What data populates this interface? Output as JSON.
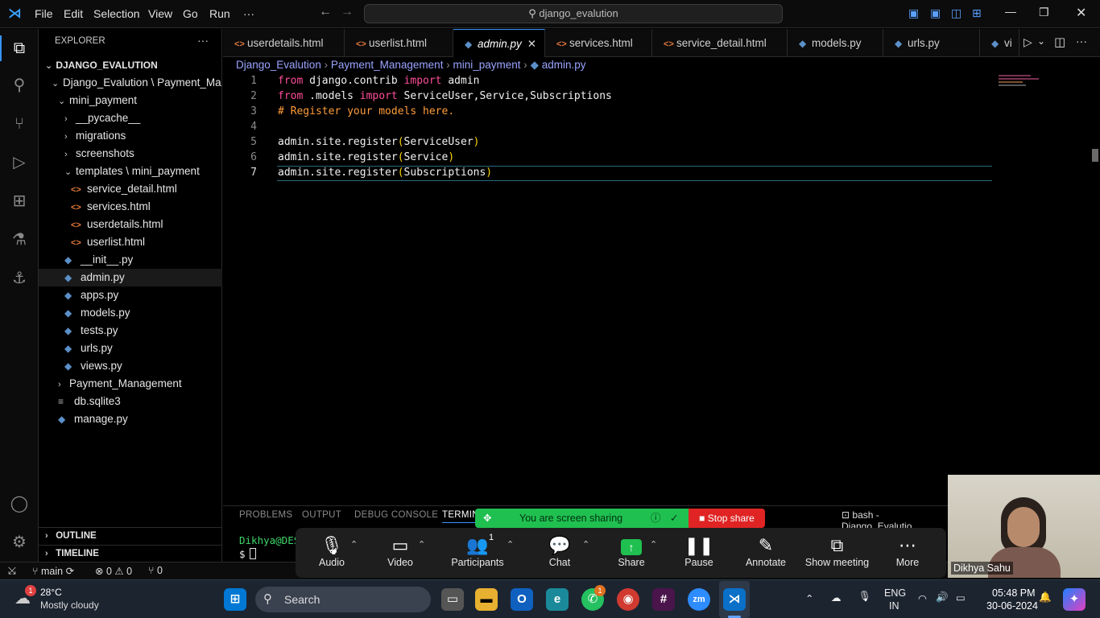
{
  "menu": {
    "file": "File",
    "edit": "Edit",
    "selection": "Selection",
    "view": "View",
    "go": "Go",
    "run": "Run",
    "more": "···"
  },
  "search": {
    "text": "django_evalution"
  },
  "explorer": {
    "title": "EXPLORER",
    "more": "···",
    "root": "DJANGO_EVALUTION",
    "items": [
      {
        "label": "Django_Evalution \\ Payment_Ma...",
        "indent": 1,
        "kind": "folder",
        "open": true
      },
      {
        "label": "mini_payment",
        "indent": 2,
        "kind": "folder",
        "open": true
      },
      {
        "label": "__pycache__",
        "indent": 3,
        "kind": "folder",
        "open": false
      },
      {
        "label": "migrations",
        "indent": 3,
        "kind": "folder",
        "open": false
      },
      {
        "label": "screenshots",
        "indent": 3,
        "kind": "folder",
        "open": false
      },
      {
        "label": "templates \\ mini_payment",
        "indent": 3,
        "kind": "folder",
        "open": true
      },
      {
        "label": "service_detail.html",
        "indent": 4,
        "kind": "html"
      },
      {
        "label": "services.html",
        "indent": 4,
        "kind": "html"
      },
      {
        "label": "userdetails.html",
        "indent": 4,
        "kind": "html"
      },
      {
        "label": "userlist.html",
        "indent": 4,
        "kind": "html"
      },
      {
        "label": "__init__.py",
        "indent": 3,
        "kind": "py"
      },
      {
        "label": "admin.py",
        "indent": 3,
        "kind": "py",
        "selected": true
      },
      {
        "label": "apps.py",
        "indent": 3,
        "kind": "py"
      },
      {
        "label": "models.py",
        "indent": 3,
        "kind": "py"
      },
      {
        "label": "tests.py",
        "indent": 3,
        "kind": "py"
      },
      {
        "label": "urls.py",
        "indent": 3,
        "kind": "py"
      },
      {
        "label": "views.py",
        "indent": 3,
        "kind": "py"
      },
      {
        "label": "Payment_Management",
        "indent": 2,
        "kind": "folder",
        "open": false
      },
      {
        "label": "db.sqlite3",
        "indent": 2,
        "kind": "db"
      },
      {
        "label": "manage.py",
        "indent": 2,
        "kind": "py"
      }
    ],
    "outline": "OUTLINE",
    "timeline": "TIMELINE"
  },
  "tabs": [
    {
      "label": "userdetails.html",
      "kind": "html"
    },
    {
      "label": "userlist.html",
      "kind": "html"
    },
    {
      "label": "admin.py",
      "kind": "py",
      "active": true
    },
    {
      "label": "services.html",
      "kind": "html"
    },
    {
      "label": "service_detail.html",
      "kind": "html"
    },
    {
      "label": "models.py",
      "kind": "py"
    },
    {
      "label": "urls.py",
      "kind": "py"
    },
    {
      "label": "vi",
      "kind": "py"
    }
  ],
  "breadcrumb": {
    "p1": "Django_Evalution",
    "p2": "Payment_Management",
    "p3": "mini_payment",
    "p4": "admin.py"
  },
  "code": {
    "lines": [
      [
        {
          "t": "from",
          "c": "kw"
        },
        {
          "t": " django.contrib "
        },
        {
          "t": "import",
          "c": "kw"
        },
        {
          "t": " admin"
        }
      ],
      [
        {
          "t": "from",
          "c": "kw"
        },
        {
          "t": " .models "
        },
        {
          "t": "import",
          "c": "kw"
        },
        {
          "t": " ServiceUser,Service,Subscriptions"
        }
      ],
      [
        {
          "t": "# Register your models here.",
          "c": "cm"
        }
      ],
      [],
      [
        {
          "t": "admin.site.register"
        },
        {
          "t": "(",
          "c": "par"
        },
        {
          "t": "ServiceUser"
        },
        {
          "t": ")",
          "c": "par"
        }
      ],
      [
        {
          "t": "admin.site.register"
        },
        {
          "t": "(",
          "c": "par"
        },
        {
          "t": "Service"
        },
        {
          "t": ")",
          "c": "par"
        }
      ],
      [
        {
          "t": "admin.site.register"
        },
        {
          "t": "(",
          "c": "par"
        },
        {
          "t": "Subscriptions"
        },
        {
          "t": ")",
          "c": "par"
        }
      ]
    ]
  },
  "panel": {
    "problems": "PROBLEMS",
    "output": "OUTPUT",
    "debug": "DEBUG CONSOLE",
    "terminal": "TERMIN",
    "terminal_name": "bash - Django_Evalutio",
    "prompt_user": "Dikhya@DES",
    "prompt_sign": "$"
  },
  "share": {
    "banner": "You are screen sharing",
    "stop": "Stop share"
  },
  "zoom": {
    "audio": "Audio",
    "video": "Video",
    "participants": "Participants",
    "participants_count": "1",
    "chat": "Chat",
    "share": "Share",
    "pause": "Pause",
    "annotate": "Annotate",
    "show_meeting": "Show meeting",
    "more": "More"
  },
  "webcam": {
    "name": "Dikhya Sahu"
  },
  "status": {
    "branch": "main",
    "errors": "0",
    "warnings": "0",
    "ports": "0"
  },
  "taskbar": {
    "temp": "28°C",
    "weather": "Mostly cloudy",
    "weather_badge": "1",
    "search": "Search",
    "whatsapp_badge": "1",
    "lang1": "ENG",
    "lang2": "IN",
    "time": "05:48 PM",
    "date": "30-06-2024"
  },
  "colors": {
    "accent": "#3794ff",
    "keyword": "#ff4f9a",
    "comment": "#ff9c3a",
    "share_green": "#20c050",
    "stop_red": "#e02424"
  }
}
